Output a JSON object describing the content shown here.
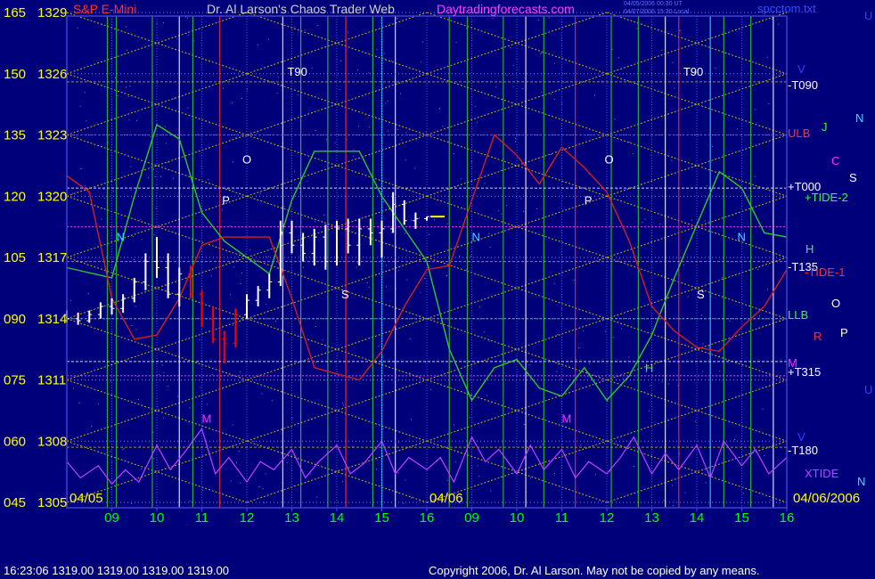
{
  "header": {
    "symbol": "S&P E-Mini",
    "title": "Dr. Al Larson's Chaos Trader Web",
    "site": "Daytradingforecasts.com",
    "file": "spcctom.txt",
    "stamp_line1": "04/05/2006 00:30 UT",
    "stamp_line2": "04/07/2006 15:30 Local"
  },
  "footer": {
    "status": "16:23:06  1319.00 1319.00 1319.00 1319.00",
    "copyright": "Copyright 2006, Dr. Al Larson. May not be copied by any means."
  },
  "date_labels": {
    "start": "04/05",
    "mid": "04/06",
    "end": "04/06/2006"
  },
  "colors": {
    "background": "#00007a",
    "y_labels": "#ffff00",
    "x_labels": "#00ff00",
    "header_title": "#d0d0d0",
    "site": "#ff00ff",
    "grid_gold": "#c8b400",
    "price_bars": "#ffffff",
    "down_bars": "#ff0000",
    "green_line": "#2ec82e",
    "red_line": "#d02020",
    "xtide": "#c040ff"
  },
  "chart_data": {
    "type": "line",
    "title": "S&P E-Mini",
    "xlabel": "",
    "ylabel": "",
    "ylim": [
      1305,
      1329
    ],
    "y_ticks": [
      {
        "left": "165",
        "right": "1329",
        "value": 1329
      },
      {
        "left": "150",
        "right": "1326",
        "value": 1326
      },
      {
        "left": "135",
        "right": "1323",
        "value": 1323
      },
      {
        "left": "120",
        "right": "1320",
        "value": 1320
      },
      {
        "left": "105",
        "right": "1317",
        "value": 1317
      },
      {
        "left": "090",
        "right": "1314",
        "value": 1314
      },
      {
        "left": "075",
        "right": "1311",
        "value": 1311
      },
      {
        "left": "060",
        "right": "1308",
        "value": 1308
      },
      {
        "left": "045",
        "right": "1305",
        "value": 1305
      }
    ],
    "x_ticks": [
      "09",
      "10",
      "11",
      "12",
      "13",
      "14",
      "15",
      "16",
      "09",
      "10",
      "11",
      "12",
      "13",
      "14",
      "15",
      "16"
    ],
    "x_range": [
      8,
      24
    ],
    "price_series": [
      {
        "t": 8.0,
        "o": 1314.2,
        "h": 1314.4,
        "l": 1313.8,
        "c": 1314.0
      },
      {
        "t": 8.25,
        "o": 1314.0,
        "h": 1314.3,
        "l": 1313.7,
        "c": 1313.9
      },
      {
        "t": 8.5,
        "o": 1313.9,
        "h": 1314.4,
        "l": 1313.8,
        "c": 1314.2
      },
      {
        "t": 8.75,
        "o": 1314.2,
        "h": 1314.8,
        "l": 1314.0,
        "c": 1314.6
      },
      {
        "t": 9.0,
        "o": 1314.6,
        "h": 1315.0,
        "l": 1314.2,
        "c": 1314.5
      },
      {
        "t": 9.25,
        "o": 1314.5,
        "h": 1315.2,
        "l": 1314.3,
        "c": 1315.0
      },
      {
        "t": 9.5,
        "o": 1315.0,
        "h": 1316.0,
        "l": 1314.8,
        "c": 1315.8
      },
      {
        "t": 9.75,
        "o": 1315.8,
        "h": 1317.2,
        "l": 1315.4,
        "c": 1316.8
      },
      {
        "t": 10.0,
        "o": 1316.8,
        "h": 1318.0,
        "l": 1316.0,
        "c": 1316.5
      },
      {
        "t": 10.25,
        "o": 1316.5,
        "h": 1317.2,
        "l": 1315.0,
        "c": 1315.2
      },
      {
        "t": 10.5,
        "o": 1315.2,
        "h": 1316.5,
        "l": 1314.6,
        "c": 1316.2
      },
      {
        "t": 10.75,
        "o": 1316.2,
        "h": 1316.6,
        "l": 1315.0,
        "c": 1315.2
      },
      {
        "t": 11.0,
        "o": 1315.2,
        "h": 1315.4,
        "l": 1313.6,
        "c": 1314.0
      },
      {
        "t": 11.25,
        "o": 1314.0,
        "h": 1314.6,
        "l": 1312.8,
        "c": 1313.0
      },
      {
        "t": 11.5,
        "o": 1313.0,
        "h": 1313.4,
        "l": 1311.8,
        "c": 1312.8
      },
      {
        "t": 11.75,
        "o": 1312.8,
        "h": 1314.5,
        "l": 1312.6,
        "c": 1314.2
      },
      {
        "t": 12.0,
        "o": 1314.2,
        "h": 1315.2,
        "l": 1314.0,
        "c": 1314.9
      },
      {
        "t": 12.25,
        "o": 1314.9,
        "h": 1315.6,
        "l": 1314.6,
        "c": 1315.4
      },
      {
        "t": 12.5,
        "o": 1315.4,
        "h": 1316.2,
        "l": 1315.0,
        "c": 1315.8
      },
      {
        "t": 12.75,
        "o": 1315.8,
        "h": 1318.8,
        "l": 1315.6,
        "c": 1318.2
      },
      {
        "t": 13.0,
        "o": 1318.2,
        "h": 1318.8,
        "l": 1317.2,
        "c": 1317.6
      },
      {
        "t": 13.25,
        "o": 1317.6,
        "h": 1318.2,
        "l": 1316.8,
        "c": 1317.2
      },
      {
        "t": 13.5,
        "o": 1317.2,
        "h": 1318.4,
        "l": 1316.6,
        "c": 1318.0
      },
      {
        "t": 13.75,
        "o": 1318.0,
        "h": 1318.6,
        "l": 1316.4,
        "c": 1316.8
      },
      {
        "t": 14.0,
        "o": 1316.8,
        "h": 1318.8,
        "l": 1316.6,
        "c": 1318.4
      },
      {
        "t": 14.25,
        "o": 1318.4,
        "h": 1318.9,
        "l": 1317.2,
        "c": 1317.6
      },
      {
        "t": 14.5,
        "o": 1317.6,
        "h": 1318.9,
        "l": 1316.6,
        "c": 1318.4
      },
      {
        "t": 14.75,
        "o": 1318.4,
        "h": 1318.9,
        "l": 1317.6,
        "c": 1318.2
      },
      {
        "t": 15.0,
        "o": 1318.2,
        "h": 1318.8,
        "l": 1317.0,
        "c": 1318.4
      },
      {
        "t": 15.25,
        "o": 1318.4,
        "h": 1320.2,
        "l": 1318.2,
        "c": 1319.6
      },
      {
        "t": 15.5,
        "o": 1319.6,
        "h": 1319.8,
        "l": 1318.6,
        "c": 1318.8
      },
      {
        "t": 15.75,
        "o": 1318.8,
        "h": 1319.2,
        "l": 1318.4,
        "c": 1318.9
      },
      {
        "t": 16.0,
        "o": 1318.9,
        "h": 1319.0,
        "l": 1318.8,
        "c": 1319.0
      }
    ],
    "down_segment": {
      "from": 10.75,
      "to": 11.75
    },
    "green_series": [
      {
        "t": 8.0,
        "v": 1316.5
      },
      {
        "t": 9.0,
        "v": 1316.0
      },
      {
        "t": 9.5,
        "v": 1320.0
      },
      {
        "t": 10.0,
        "v": 1323.5
      },
      {
        "t": 10.5,
        "v": 1322.8
      },
      {
        "t": 11.0,
        "v": 1319.2
      },
      {
        "t": 11.5,
        "v": 1317.8
      },
      {
        "t": 12.5,
        "v": 1316.2
      },
      {
        "t": 13.0,
        "v": 1319.8
      },
      {
        "t": 13.5,
        "v": 1322.2
      },
      {
        "t": 14.5,
        "v": 1322.2
      },
      {
        "t": 15.0,
        "v": 1320.0
      },
      {
        "t": 15.5,
        "v": 1318.4
      },
      {
        "t": 16.0,
        "v": 1316.8
      },
      {
        "t": 16.5,
        "v": 1312.5
      },
      {
        "t": 17.0,
        "v": 1310.0
      },
      {
        "t": 17.5,
        "v": 1311.6
      },
      {
        "t": 18.0,
        "v": 1312.0
      },
      {
        "t": 18.5,
        "v": 1310.6
      },
      {
        "t": 19.0,
        "v": 1310.2
      },
      {
        "t": 19.5,
        "v": 1311.6
      },
      {
        "t": 20.0,
        "v": 1310.0
      },
      {
        "t": 20.5,
        "v": 1311.2
      },
      {
        "t": 21.0,
        "v": 1313.2
      },
      {
        "t": 21.5,
        "v": 1316.0
      },
      {
        "t": 22.0,
        "v": 1318.6
      },
      {
        "t": 22.5,
        "v": 1321.2
      },
      {
        "t": 23.0,
        "v": 1320.4
      },
      {
        "t": 23.5,
        "v": 1318.2
      },
      {
        "t": 24.0,
        "v": 1318.0
      }
    ],
    "red_series": [
      {
        "t": 8.0,
        "v": 1321.0
      },
      {
        "t": 8.5,
        "v": 1320.2
      },
      {
        "t": 9.0,
        "v": 1315.0
      },
      {
        "t": 9.5,
        "v": 1313.0
      },
      {
        "t": 10.0,
        "v": 1313.2
      },
      {
        "t": 10.5,
        "v": 1315.0
      },
      {
        "t": 11.0,
        "v": 1317.6
      },
      {
        "t": 11.5,
        "v": 1318.0
      },
      {
        "t": 12.5,
        "v": 1318.0
      },
      {
        "t": 13.0,
        "v": 1315.0
      },
      {
        "t": 13.5,
        "v": 1311.6
      },
      {
        "t": 14.5,
        "v": 1311.0
      },
      {
        "t": 15.0,
        "v": 1312.4
      },
      {
        "t": 15.5,
        "v": 1314.6
      },
      {
        "t": 16.0,
        "v": 1316.4
      },
      {
        "t": 16.5,
        "v": 1316.6
      },
      {
        "t": 17.0,
        "v": 1319.8
      },
      {
        "t": 17.5,
        "v": 1323.0
      },
      {
        "t": 18.0,
        "v": 1322.0
      },
      {
        "t": 18.5,
        "v": 1320.6
      },
      {
        "t": 19.0,
        "v": 1322.4
      },
      {
        "t": 19.5,
        "v": 1321.4
      },
      {
        "t": 20.0,
        "v": 1320.2
      },
      {
        "t": 20.5,
        "v": 1317.8
      },
      {
        "t": 21.0,
        "v": 1314.6
      },
      {
        "t": 21.5,
        "v": 1313.4
      },
      {
        "t": 22.0,
        "v": 1312.6
      },
      {
        "t": 22.5,
        "v": 1312.4
      },
      {
        "t": 23.0,
        "v": 1313.6
      },
      {
        "t": 23.5,
        "v": 1314.6
      },
      {
        "t": 24.0,
        "v": 1316.4
      }
    ],
    "xtide_series": [
      {
        "t": 8.0,
        "v": 1307.0
      },
      {
        "t": 8.3,
        "v": 1306.2
      },
      {
        "t": 8.7,
        "v": 1306.8
      },
      {
        "t": 9.0,
        "v": 1305.9
      },
      {
        "t": 9.3,
        "v": 1306.6
      },
      {
        "t": 9.6,
        "v": 1306.0
      },
      {
        "t": 10.0,
        "v": 1307.8
      },
      {
        "t": 10.3,
        "v": 1306.6
      },
      {
        "t": 10.6,
        "v": 1307.4
      },
      {
        "t": 11.0,
        "v": 1308.6
      },
      {
        "t": 11.3,
        "v": 1306.4
      },
      {
        "t": 11.6,
        "v": 1307.2
      },
      {
        "t": 12.0,
        "v": 1306.0
      },
      {
        "t": 12.3,
        "v": 1307.0
      },
      {
        "t": 12.6,
        "v": 1306.6
      },
      {
        "t": 13.0,
        "v": 1307.6
      },
      {
        "t": 13.3,
        "v": 1306.2
      },
      {
        "t": 13.6,
        "v": 1307.0
      },
      {
        "t": 14.0,
        "v": 1307.8
      },
      {
        "t": 14.3,
        "v": 1306.4
      },
      {
        "t": 14.6,
        "v": 1306.9
      },
      {
        "t": 15.0,
        "v": 1308.0
      },
      {
        "t": 15.3,
        "v": 1306.4
      },
      {
        "t": 15.6,
        "v": 1307.2
      },
      {
        "t": 16.0,
        "v": 1306.6
      },
      {
        "t": 16.3,
        "v": 1307.2
      },
      {
        "t": 16.6,
        "v": 1306.0
      },
      {
        "t": 17.0,
        "v": 1308.2
      },
      {
        "t": 17.3,
        "v": 1307.0
      },
      {
        "t": 17.6,
        "v": 1307.6
      },
      {
        "t": 18.0,
        "v": 1306.4
      },
      {
        "t": 18.3,
        "v": 1307.8
      },
      {
        "t": 18.6,
        "v": 1306.6
      },
      {
        "t": 19.0,
        "v": 1307.6
      },
      {
        "t": 19.3,
        "v": 1306.2
      },
      {
        "t": 19.6,
        "v": 1307.0
      },
      {
        "t": 20.0,
        "v": 1306.4
      },
      {
        "t": 20.3,
        "v": 1307.2
      },
      {
        "t": 20.6,
        "v": 1308.2
      },
      {
        "t": 21.0,
        "v": 1306.4
      },
      {
        "t": 21.3,
        "v": 1307.4
      },
      {
        "t": 21.6,
        "v": 1306.6
      },
      {
        "t": 22.0,
        "v": 1307.8
      },
      {
        "t": 22.3,
        "v": 1306.2
      },
      {
        "t": 22.6,
        "v": 1308.0
      },
      {
        "t": 23.0,
        "v": 1306.8
      },
      {
        "t": 23.3,
        "v": 1307.6
      },
      {
        "t": 23.6,
        "v": 1306.4
      },
      {
        "t": 24.0,
        "v": 1307.2
      }
    ],
    "hlines": [
      {
        "label": "-T090",
        "value": 1325.6,
        "color": "#c8b400"
      },
      {
        "label": "ULB",
        "value": 1323.0,
        "color": "#ff3030"
      },
      {
        "label": "+T000",
        "value": 1320.4,
        "color": "#ffffff"
      },
      {
        "label": "-T135",
        "value": 1316.8,
        "color": "#c8b400"
      },
      {
        "label": "LLB",
        "value": 1314.0,
        "color": "#30ff30"
      },
      {
        "label": "+T315",
        "value": 1311.9,
        "color": "#ffffff"
      },
      {
        "label": "-T180",
        "value": 1307.7,
        "color": "#c8b400"
      }
    ],
    "vlines": [
      {
        "t": 8.9,
        "color": "#2ec82e"
      },
      {
        "t": 9.1,
        "color": "#2ec82e"
      },
      {
        "t": 9.9,
        "color": "#2ec82e"
      },
      {
        "t": 10.5,
        "color": "#ffffff"
      },
      {
        "t": 10.8,
        "color": "#2ec82e"
      },
      {
        "t": 11.4,
        "color": "#ff3030"
      },
      {
        "t": 12.8,
        "color": "#ffffff"
      },
      {
        "t": 13.2,
        "color": "#2ec82e"
      },
      {
        "t": 13.8,
        "color": "#2ec82e"
      },
      {
        "t": 14.2,
        "color": "#ff3030"
      },
      {
        "t": 14.8,
        "color": "#2ec82e"
      },
      {
        "t": 15.0,
        "color": "#30e0ff"
      },
      {
        "t": 15.3,
        "color": "#ffffff"
      },
      {
        "t": 16.5,
        "color": "#2ec82e"
      },
      {
        "t": 16.9,
        "color": "#2ec82e"
      },
      {
        "t": 17.7,
        "color": "#2ec82e"
      },
      {
        "t": 18.2,
        "color": "#ffffff"
      },
      {
        "t": 18.6,
        "color": "#2ec82e"
      },
      {
        "t": 19.3,
        "color": "#ff3030"
      },
      {
        "t": 20.1,
        "color": "#2ec82e"
      },
      {
        "t": 20.7,
        "color": "#2ec82e"
      },
      {
        "t": 21.3,
        "color": "#ffffff"
      },
      {
        "t": 21.6,
        "color": "#ff3030"
      },
      {
        "t": 22.3,
        "color": "#30e0ff"
      },
      {
        "t": 22.6,
        "color": "#2ec82e"
      },
      {
        "t": 23.2,
        "color": "#2ec82e"
      },
      {
        "t": 23.7,
        "color": "#ffffff"
      }
    ],
    "annotations": [
      {
        "text": "T90",
        "t": 12.9,
        "v": 1325.9,
        "color": "#ffffff"
      },
      {
        "text": "T90",
        "t": 21.7,
        "v": 1325.9,
        "color": "#ffffff"
      },
      {
        "text": "O",
        "t": 11.9,
        "v": 1321.6,
        "color": "#ffffff"
      },
      {
        "text": "P",
        "t": 11.45,
        "v": 1319.6,
        "color": "#ffffff"
      },
      {
        "text": "N",
        "t": 9.1,
        "v": 1317.8,
        "color": "#30e0ff"
      },
      {
        "text": "S",
        "t": 14.1,
        "v": 1315.0,
        "color": "#ffffff"
      },
      {
        "text": "M",
        "t": 11.0,
        "v": 1308.9,
        "color": "#ff30ff"
      },
      {
        "text": "N",
        "t": 17.0,
        "v": 1317.8,
        "color": "#30e0ff"
      },
      {
        "text": "O",
        "t": 19.95,
        "v": 1321.6,
        "color": "#ffffff"
      },
      {
        "text": "P",
        "t": 19.5,
        "v": 1319.6,
        "color": "#ffffff"
      },
      {
        "text": "S",
        "t": 22.0,
        "v": 1315.0,
        "color": "#ffffff"
      },
      {
        "text": "M",
        "t": 19.0,
        "v": 1308.9,
        "color": "#ff30ff"
      },
      {
        "text": "H",
        "t": 20.85,
        "v": 1311.4,
        "color": "#30ff30"
      },
      {
        "text": "N",
        "t": 22.9,
        "v": 1317.8,
        "color": "#30e0ff"
      }
    ],
    "right_labels": [
      {
        "text": "U",
        "color": "#3040ff",
        "x": 970,
        "y": 10
      },
      {
        "text": "V",
        "color": "#3040ff",
        "x": 895,
        "y": 70
      },
      {
        "text": "-T090",
        "color": "#ffffff",
        "x": 884,
        "y": 88
      },
      {
        "text": "N",
        "color": "#30e0ff",
        "x": 960,
        "y": 125
      },
      {
        "text": "J",
        "color": "#30ff30",
        "x": 922,
        "y": 135
      },
      {
        "text": "ULB",
        "color": "#ff3030",
        "x": 884,
        "y": 142
      },
      {
        "text": "C",
        "color": "#ff30ff",
        "x": 933,
        "y": 173
      },
      {
        "text": "S",
        "color": "#ffffff",
        "x": 953,
        "y": 192
      },
      {
        "text": "+T000",
        "color": "#ffffff",
        "x": 884,
        "y": 202
      },
      {
        "text": "+TIDE-2",
        "color": "#30ff30",
        "x": 903,
        "y": 214
      },
      {
        "text": "H",
        "color": "#30ff30",
        "x": 904,
        "y": 272
      },
      {
        "text": "-T135",
        "color": "#ffffff",
        "x": 884,
        "y": 292
      },
      {
        "text": "-TIDE-1",
        "color": "#ff3030",
        "x": 903,
        "y": 298
      },
      {
        "text": "O",
        "color": "#ffffff",
        "x": 933,
        "y": 333
      },
      {
        "text": "LLB",
        "color": "#30ff30",
        "x": 884,
        "y": 346
      },
      {
        "text": "R",
        "color": "#ff3030",
        "x": 913,
        "y": 370
      },
      {
        "text": "P",
        "color": "#ffffff",
        "x": 943,
        "y": 366
      },
      {
        "text": "M",
        "color": "#ff30ff",
        "x": 884,
        "y": 400
      },
      {
        "text": "+T315",
        "color": "#ffffff",
        "x": 884,
        "y": 410
      },
      {
        "text": "U",
        "color": "#3040ff",
        "x": 970,
        "y": 430
      },
      {
        "text": "V",
        "color": "#3040ff",
        "x": 895,
        "y": 483
      },
      {
        "text": "-T180",
        "color": "#ffffff",
        "x": 884,
        "y": 498
      },
      {
        "text": "XTIDE",
        "color": "#c040ff",
        "x": 903,
        "y": 524
      },
      {
        "text": "N",
        "color": "#30e0ff",
        "x": 962,
        "y": 533
      }
    ]
  }
}
